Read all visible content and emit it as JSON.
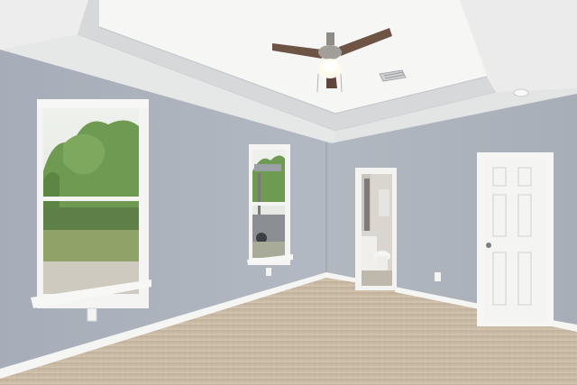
{
  "scene": {
    "type": "photo",
    "subject": "empty-bedroom-interior",
    "elements": [
      "tray-ceiling",
      "ceiling-fan",
      "ceiling-vent",
      "smoke-detector",
      "left-window",
      "middle-window",
      "bathroom-doorway",
      "closet-door",
      "baseboards",
      "carpet-floor",
      "wall-outlets"
    ]
  },
  "colors": {
    "wall_left": "#a9b0ba",
    "wall_right": "#aeb4bd",
    "ceiling": "#f2f2f0",
    "tray_edge": "#d9dbdc",
    "carpet": "#c9b9a3",
    "trim": "#f7f7f5",
    "door": "#f4f4f2",
    "fan_blade": "#6e5445",
    "foliage": "#6f9a52",
    "sky": "#e8ece6",
    "lawn": "#8fa268"
  }
}
